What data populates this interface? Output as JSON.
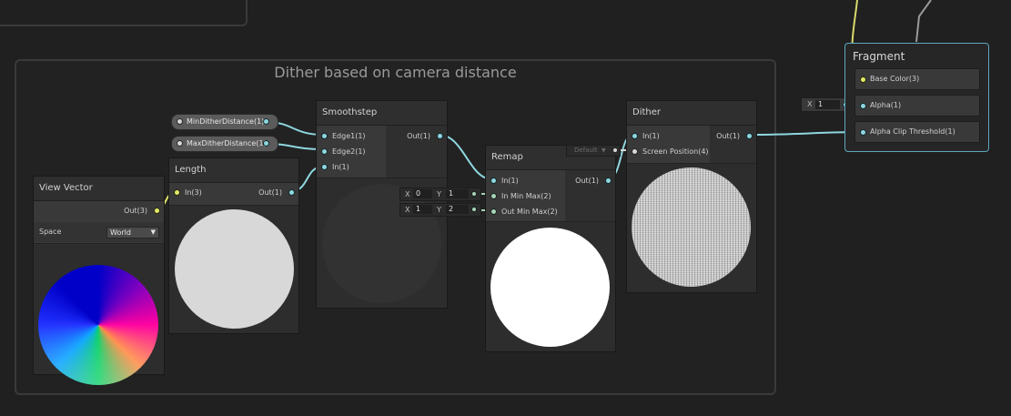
{
  "group": {
    "title": "Dither based on camera distance"
  },
  "properties": {
    "min_dither": "MinDitherDistance(1)",
    "max_dither": "MaxDitherDistance(1)"
  },
  "view_vector": {
    "title": "View Vector",
    "out": "Out(3)",
    "space_label": "Space",
    "space_value": "World"
  },
  "length": {
    "title": "Length",
    "in": "In(3)",
    "out": "Out(1)"
  },
  "smoothstep": {
    "title": "Smoothstep",
    "edge1": "Edge1(1)",
    "edge2": "Edge2(1)",
    "in": "In(1)",
    "out": "Out(1)"
  },
  "remap": {
    "title": "Remap",
    "in": "In(1)",
    "in_min_max": "In Min Max(2)",
    "out_min_max": "Out Min Max(2)",
    "out": "Out(1)",
    "in_x_label": "X",
    "in_x": "0",
    "in_y_label": "Y",
    "in_y": "1",
    "out_x_label": "X",
    "out_x": "1",
    "out_y_label": "Y",
    "out_y": "2"
  },
  "dither": {
    "title": "Dither",
    "in": "In(1)",
    "screen_position": "Screen Position(4)",
    "screen_default": "Default",
    "out": "Out(1)"
  },
  "fragment": {
    "title": "Fragment",
    "base_color": "Base Color(3)",
    "alpha": "Alpha(1)",
    "alpha_clip": "Alpha Clip Threshold(1)",
    "alpha_x_label": "X",
    "alpha_x": "1"
  },
  "colors": {
    "wire_float": "#8fd7e0",
    "wire_vector": "#e2ea6a",
    "wire_vector2": "#a8d3b7",
    "fragment_border": "#5ea7c0"
  }
}
